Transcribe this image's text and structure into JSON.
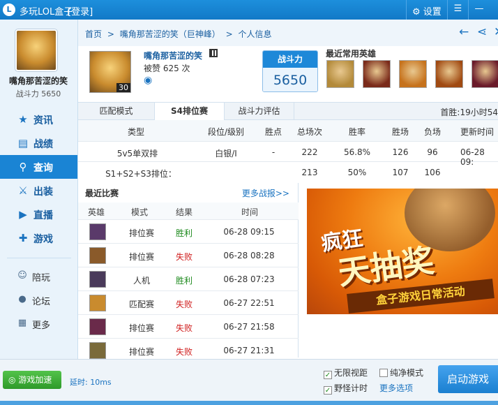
{
  "window": {
    "title": "多玩LOL盒子",
    "login": "[登录]",
    "settings_label": "设置",
    "settings_icon": "gear-icon",
    "dropdown_icon": "menu-icon",
    "minimize_icon": "minimize-icon"
  },
  "sidebar": {
    "user_name": "嘴角那苦涩的笑",
    "power_text": "战斗力 5650",
    "nav": [
      {
        "label": "资讯",
        "icon": "star-icon"
      },
      {
        "label": "战绩",
        "icon": "scoreboard-icon"
      },
      {
        "label": "查询",
        "icon": "search-icon"
      },
      {
        "label": "出装",
        "icon": "equipment-icon"
      },
      {
        "label": "直播",
        "icon": "play-icon"
      },
      {
        "label": "游戏",
        "icon": "gamepad-icon"
      }
    ],
    "sub": [
      {
        "label": "陪玩",
        "icon": "people-icon"
      },
      {
        "label": "论坛",
        "icon": "chat-icon"
      },
      {
        "label": "更多",
        "icon": "grid-icon"
      }
    ]
  },
  "breadcrumb": {
    "home": "首页",
    "sep": ">",
    "player": "嘴角那苦涩的笑（巨神峰）",
    "page": "个人信息",
    "back_icon": "back-arrow-icon",
    "share_icon": "share-icon"
  },
  "profile": {
    "name": "嘴角那苦涩的笑",
    "likes": "被赞 625 次",
    "level": "30",
    "power_label": "战斗力",
    "power_value": "5650",
    "recent_heroes_label": "最近常用英雄",
    "heroes": [
      {
        "name": "hero-1",
        "color": "#b38a3a"
      },
      {
        "name": "hero-2",
        "color": "#7a2a1a"
      },
      {
        "name": "hero-3",
        "color": "#c6721c"
      },
      {
        "name": "hero-4",
        "color": "#a04a12"
      },
      {
        "name": "hero-5",
        "color": "#6a1a2a"
      }
    ]
  },
  "tabs": {
    "items": [
      "匹配模式",
      "S4排位赛",
      "战斗力评估"
    ],
    "active_index": 1,
    "first_win": "首胜:19小时54"
  },
  "stats": {
    "headers": [
      "类型",
      "段位/级别",
      "胜点",
      "总场次",
      "胜率",
      "胜场",
      "负场",
      "更新时间"
    ],
    "rows": [
      [
        "5v5单双排",
        "白银/I",
        "-",
        "222",
        "56.8%",
        "126",
        "96",
        "06-28 09:"
      ],
      [
        "S1+S2+S3排位：",
        "",
        "",
        "213",
        "50%",
        "107",
        "106",
        ""
      ]
    ]
  },
  "recent": {
    "title": "最近比赛",
    "more": "更多战报>>",
    "headers": [
      "英雄",
      "模式",
      "结果",
      "时间"
    ],
    "matches": [
      {
        "mode": "排位赛",
        "result": "胜利",
        "win": true,
        "time": "06-28 09:15",
        "color": "#5a3a6a"
      },
      {
        "mode": "排位赛",
        "result": "失败",
        "win": false,
        "time": "06-28 08:28",
        "color": "#8a5a2a"
      },
      {
        "mode": "人机",
        "result": "胜利",
        "win": true,
        "time": "06-28 07:23",
        "color": "#4a3a5a"
      },
      {
        "mode": "匹配赛",
        "result": "失败",
        "win": false,
        "time": "06-27 22:51",
        "color": "#c98b2e"
      },
      {
        "mode": "排位赛",
        "result": "失败",
        "win": false,
        "time": "06-27 21:58",
        "color": "#6a2a4a"
      },
      {
        "mode": "排位赛",
        "result": "失败",
        "win": false,
        "time": "06-27 21:31",
        "color": "#7a6a3a"
      }
    ]
  },
  "banner": {
    "line1": "疯狂",
    "line2": "天抽奖",
    "line3": "盒子游戏日常活动"
  },
  "footer": {
    "accel_label": "游戏加速",
    "latency": "延时: 10ms",
    "options": [
      {
        "label": "无限视距",
        "checked": true
      },
      {
        "label": "纯净模式",
        "checked": false
      },
      {
        "label": "野怪计时",
        "checked": true
      }
    ],
    "more_options": "更多选项",
    "start_label": "启动游戏"
  }
}
